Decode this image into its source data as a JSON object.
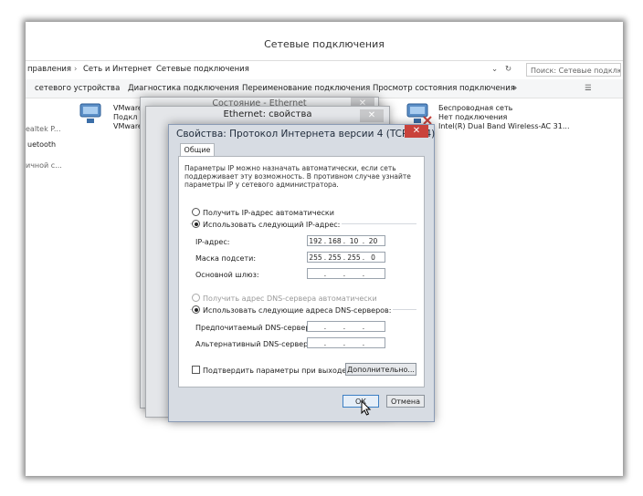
{
  "main_window": {
    "title": "Сетевые подключения",
    "breadcrumb": [
      "правления",
      "Сеть и Интернет",
      "Сетевые подключения"
    ],
    "search_placeholder": "Поиск: Сетевые подключения"
  },
  "toolbar": {
    "items": [
      "сетевого устройства",
      "Диагностика подключения",
      "Переименование подключения",
      "Просмотр состояния подключения",
      "»"
    ]
  },
  "connections": [
    {
      "name": "VMware",
      "line2": "Подкл",
      "line3": "VMware"
    },
    {
      "name": "Беспроводная сеть",
      "line2": "Нет подключения",
      "line3": "Intel(R) Dual Band Wireless-AC 31..."
    }
  ],
  "left_items": [
    "ealtek P...",
    "uetooth",
    "ичной с..."
  ],
  "back_windows": {
    "status_title": "Состояние - Ethernet",
    "props_title": "Ethernet: свойства"
  },
  "dialog": {
    "title": "Свойства: Протокол Интернета версии 4 (TCP/IPv4)",
    "tab": "Общие",
    "description": [
      "Параметры IP можно назначать автоматически, если сеть",
      "поддерживает эту возможность. В противном случае узнайте",
      "параметры IP у сетевого администратора."
    ],
    "ip_auto": "Получить IP-адрес автоматически",
    "ip_manual": "Использовать следующий IP-адрес:",
    "ip_label": "IP-адрес:",
    "ip_value": [
      "192",
      "168",
      "10",
      "20"
    ],
    "mask_label": "Маска подсети:",
    "mask_value": [
      "255",
      "255",
      "255",
      "0"
    ],
    "gateway_label": "Основной шлюз:",
    "dns_auto": "Получить адрес DNS-сервера автоматически",
    "dns_manual": "Использовать следующие адреса DNS-серверов:",
    "dns_pref_label": "Предпочитаемый DNS-сервер:",
    "dns_alt_label": "Альтернативный DNS-сервер:",
    "confirm_label": "Подтвердить параметры при выходе",
    "advanced_button": "Дополнительно...",
    "ok_button": "ОК",
    "cancel_button": "Отмена",
    "close_symbol": "✕"
  }
}
